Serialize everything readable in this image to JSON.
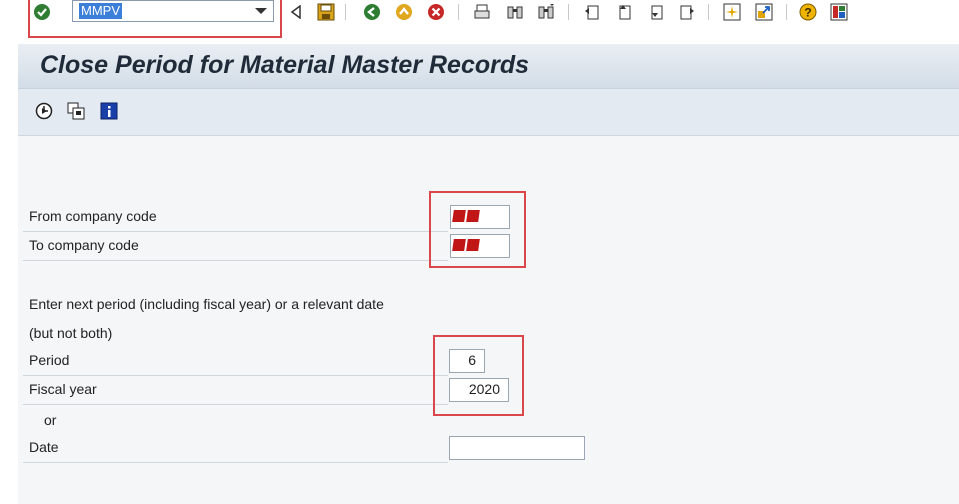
{
  "toolbar": {
    "command_field_value": "MMPV",
    "icons": [
      "enter-icon",
      "back-icon",
      "save-icon",
      "nav-back-icon",
      "exit-icon",
      "cancel-icon",
      "print-icon",
      "find-icon",
      "find-next-icon",
      "first-page-icon",
      "previous-page-icon",
      "next-page-icon",
      "last-page-icon",
      "create-session-icon",
      "shortcut-icon",
      "help-icon",
      "layout-icon"
    ]
  },
  "page": {
    "title": "Close Period for Material Master Records",
    "app_toolbar_icons": [
      "execute-icon",
      "variant-icon",
      "info-icon"
    ]
  },
  "form": {
    "from_company_code_label": "From company code",
    "to_company_code_label": "To company code",
    "instruction_line1": "Enter next period (including fiscal year) or a relevant date",
    "instruction_line2": "(but not both)",
    "period_label": "Period",
    "period_value": "6",
    "fiscal_year_label": "Fiscal year",
    "fiscal_year_value": "2020",
    "or_label": "or",
    "date_label": "Date",
    "date_value": ""
  },
  "colors": {
    "highlight": "#d9474a",
    "command_selection": "#3c7fd8",
    "redaction": "#c01616"
  }
}
